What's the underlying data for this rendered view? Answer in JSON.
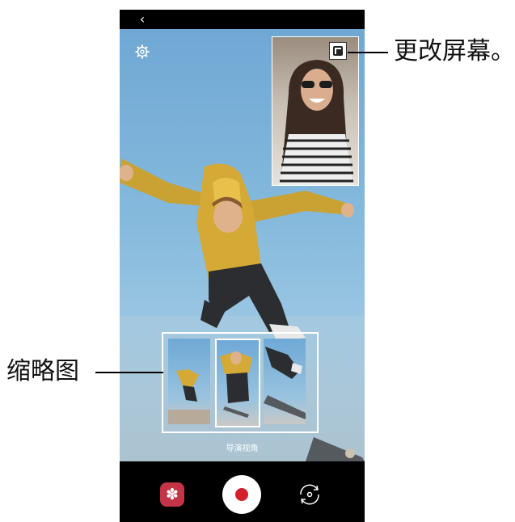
{
  "phone": {
    "back_glyph": "‹",
    "mode_label": "导演视角",
    "icons": {
      "back": "chevron-left-icon",
      "settings": "gear-icon",
      "pip_toggle": "change-screen-icon",
      "effects": "flower-effects-icon",
      "record": "record-icon",
      "switch": "switch-camera-icon"
    },
    "colors": {
      "effects_bg": "#c43447",
      "record_dot": "#d3202a",
      "sky": "#86badd"
    },
    "effects_glyph": "✽"
  },
  "callouts": {
    "change_screen": "更改屏幕。",
    "thumbnails": "缩略图"
  }
}
